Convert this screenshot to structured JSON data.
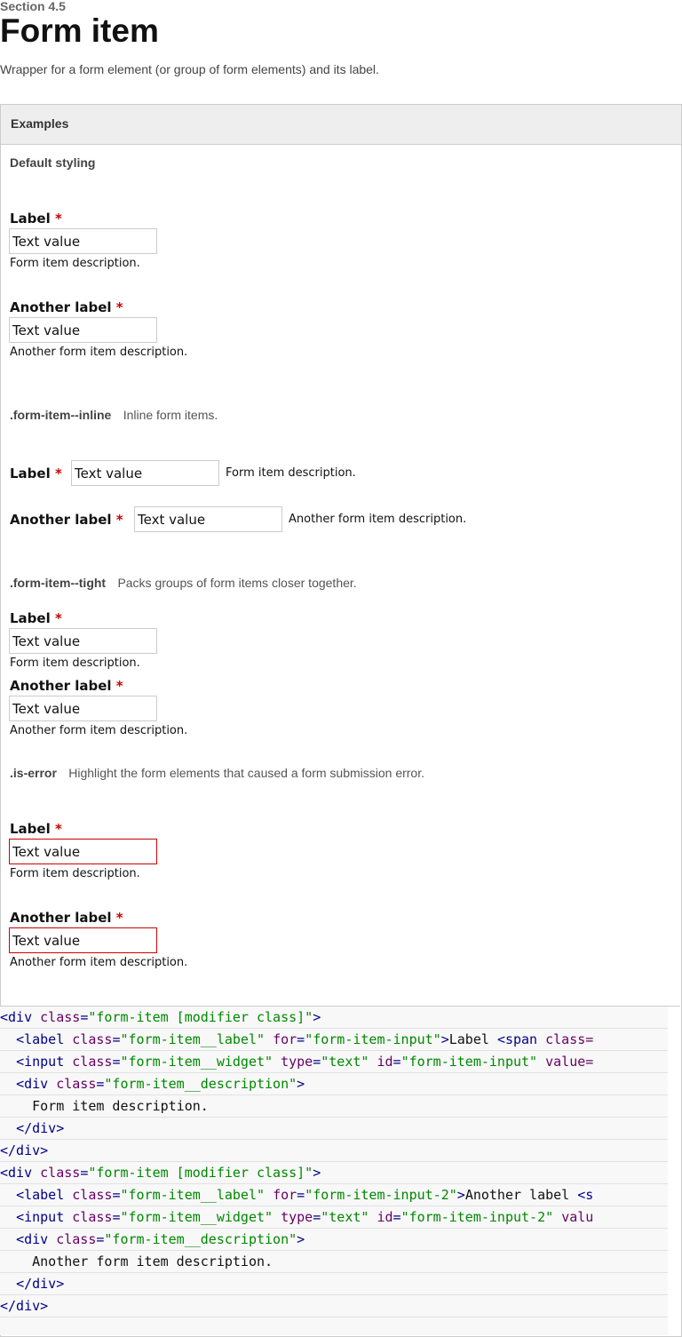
{
  "section_label": "Section 4.5",
  "page_title": "Form item",
  "page_description": "Wrapper for a form element (or group of form elements) and its label.",
  "examples_title": "Examples",
  "default_heading": "Default styling",
  "required_mark": "*",
  "colors": {
    "required": "#cc0000",
    "error_border": "#cc0000",
    "code_tag": "#000088",
    "code_attr": "#660066",
    "code_string": "#008800"
  },
  "items": {
    "label": "Label",
    "another_label": "Another label",
    "value": "Text value",
    "description": "Form item description.",
    "another_description": "Another form item description."
  },
  "modifiers": {
    "inline": {
      "name": ".form-item--inline",
      "description": "Inline form items."
    },
    "tight": {
      "name": ".form-item--tight",
      "description": "Packs groups of form items closer together."
    },
    "error": {
      "name": ".is-error",
      "description": "Highlight the form elements that caused a form submission error."
    }
  },
  "code_lines": [
    [
      {
        "t": "tag",
        "s": "<div "
      },
      {
        "t": "attr",
        "s": "class"
      },
      {
        "t": "tag",
        "s": "="
      },
      {
        "t": "str",
        "s": "\"form-item [modifier class]\""
      },
      {
        "t": "tag",
        "s": ">"
      }
    ],
    [
      {
        "t": "txt",
        "s": "  "
      },
      {
        "t": "tag",
        "s": "<label "
      },
      {
        "t": "attr",
        "s": "class"
      },
      {
        "t": "tag",
        "s": "="
      },
      {
        "t": "str",
        "s": "\"form-item__label\""
      },
      {
        "t": "txt",
        "s": " "
      },
      {
        "t": "attr",
        "s": "for"
      },
      {
        "t": "tag",
        "s": "="
      },
      {
        "t": "str",
        "s": "\"form-item-input\""
      },
      {
        "t": "tag",
        "s": ">"
      },
      {
        "t": "txt",
        "s": "Label "
      },
      {
        "t": "tag",
        "s": "<span "
      },
      {
        "t": "attr",
        "s": "class="
      }
    ],
    [
      {
        "t": "txt",
        "s": "  "
      },
      {
        "t": "tag",
        "s": "<input "
      },
      {
        "t": "attr",
        "s": "class"
      },
      {
        "t": "tag",
        "s": "="
      },
      {
        "t": "str",
        "s": "\"form-item__widget\""
      },
      {
        "t": "txt",
        "s": " "
      },
      {
        "t": "attr",
        "s": "type"
      },
      {
        "t": "tag",
        "s": "="
      },
      {
        "t": "str",
        "s": "\"text\""
      },
      {
        "t": "txt",
        "s": " "
      },
      {
        "t": "attr",
        "s": "id"
      },
      {
        "t": "tag",
        "s": "="
      },
      {
        "t": "str",
        "s": "\"form-item-input\""
      },
      {
        "t": "txt",
        "s": " "
      },
      {
        "t": "attr",
        "s": "value="
      }
    ],
    [
      {
        "t": "txt",
        "s": "  "
      },
      {
        "t": "tag",
        "s": "<div "
      },
      {
        "t": "attr",
        "s": "class"
      },
      {
        "t": "tag",
        "s": "="
      },
      {
        "t": "str",
        "s": "\"form-item__description\""
      },
      {
        "t": "tag",
        "s": ">"
      }
    ],
    [
      {
        "t": "txt",
        "s": "    Form item description."
      }
    ],
    [
      {
        "t": "txt",
        "s": "  "
      },
      {
        "t": "tag",
        "s": "</div>"
      }
    ],
    [
      {
        "t": "tag",
        "s": "</div>"
      }
    ],
    [
      {
        "t": "tag",
        "s": "<div "
      },
      {
        "t": "attr",
        "s": "class"
      },
      {
        "t": "tag",
        "s": "="
      },
      {
        "t": "str",
        "s": "\"form-item [modifier class]\""
      },
      {
        "t": "tag",
        "s": ">"
      }
    ],
    [
      {
        "t": "txt",
        "s": "  "
      },
      {
        "t": "tag",
        "s": "<label "
      },
      {
        "t": "attr",
        "s": "class"
      },
      {
        "t": "tag",
        "s": "="
      },
      {
        "t": "str",
        "s": "\"form-item__label\""
      },
      {
        "t": "txt",
        "s": " "
      },
      {
        "t": "attr",
        "s": "for"
      },
      {
        "t": "tag",
        "s": "="
      },
      {
        "t": "str",
        "s": "\"form-item-input-2\""
      },
      {
        "t": "tag",
        "s": ">"
      },
      {
        "t": "txt",
        "s": "Another label "
      },
      {
        "t": "tag",
        "s": "<s"
      }
    ],
    [
      {
        "t": "txt",
        "s": "  "
      },
      {
        "t": "tag",
        "s": "<input "
      },
      {
        "t": "attr",
        "s": "class"
      },
      {
        "t": "tag",
        "s": "="
      },
      {
        "t": "str",
        "s": "\"form-item__widget\""
      },
      {
        "t": "txt",
        "s": " "
      },
      {
        "t": "attr",
        "s": "type"
      },
      {
        "t": "tag",
        "s": "="
      },
      {
        "t": "str",
        "s": "\"text\""
      },
      {
        "t": "txt",
        "s": " "
      },
      {
        "t": "attr",
        "s": "id"
      },
      {
        "t": "tag",
        "s": "="
      },
      {
        "t": "str",
        "s": "\"form-item-input-2\""
      },
      {
        "t": "txt",
        "s": " "
      },
      {
        "t": "attr",
        "s": "valu"
      }
    ],
    [
      {
        "t": "txt",
        "s": "  "
      },
      {
        "t": "tag",
        "s": "<div "
      },
      {
        "t": "attr",
        "s": "class"
      },
      {
        "t": "tag",
        "s": "="
      },
      {
        "t": "str",
        "s": "\"form-item__description\""
      },
      {
        "t": "tag",
        "s": ">"
      }
    ],
    [
      {
        "t": "txt",
        "s": "    Another form item description."
      }
    ],
    [
      {
        "t": "txt",
        "s": "  "
      },
      {
        "t": "tag",
        "s": "</div>"
      }
    ],
    [
      {
        "t": "tag",
        "s": "</div>"
      }
    ],
    []
  ]
}
